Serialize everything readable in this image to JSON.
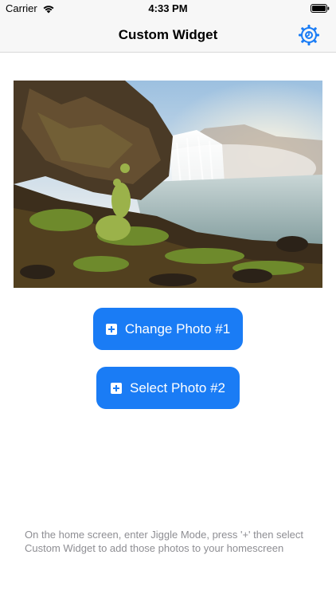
{
  "status_bar": {
    "carrier": "Carrier",
    "time": "4:33 PM"
  },
  "nav": {
    "title": "Custom Widget",
    "settings_icon": "gear-icon",
    "accent_color": "#1a7cf5"
  },
  "buttons": {
    "change_photo_1": "Change Photo #1",
    "select_photo_2": "Select Photo #2"
  },
  "footer": {
    "instructions": "On the home screen, enter Jiggle Mode, press '+' then select Custom Widget to add those photos to your homescreen"
  }
}
